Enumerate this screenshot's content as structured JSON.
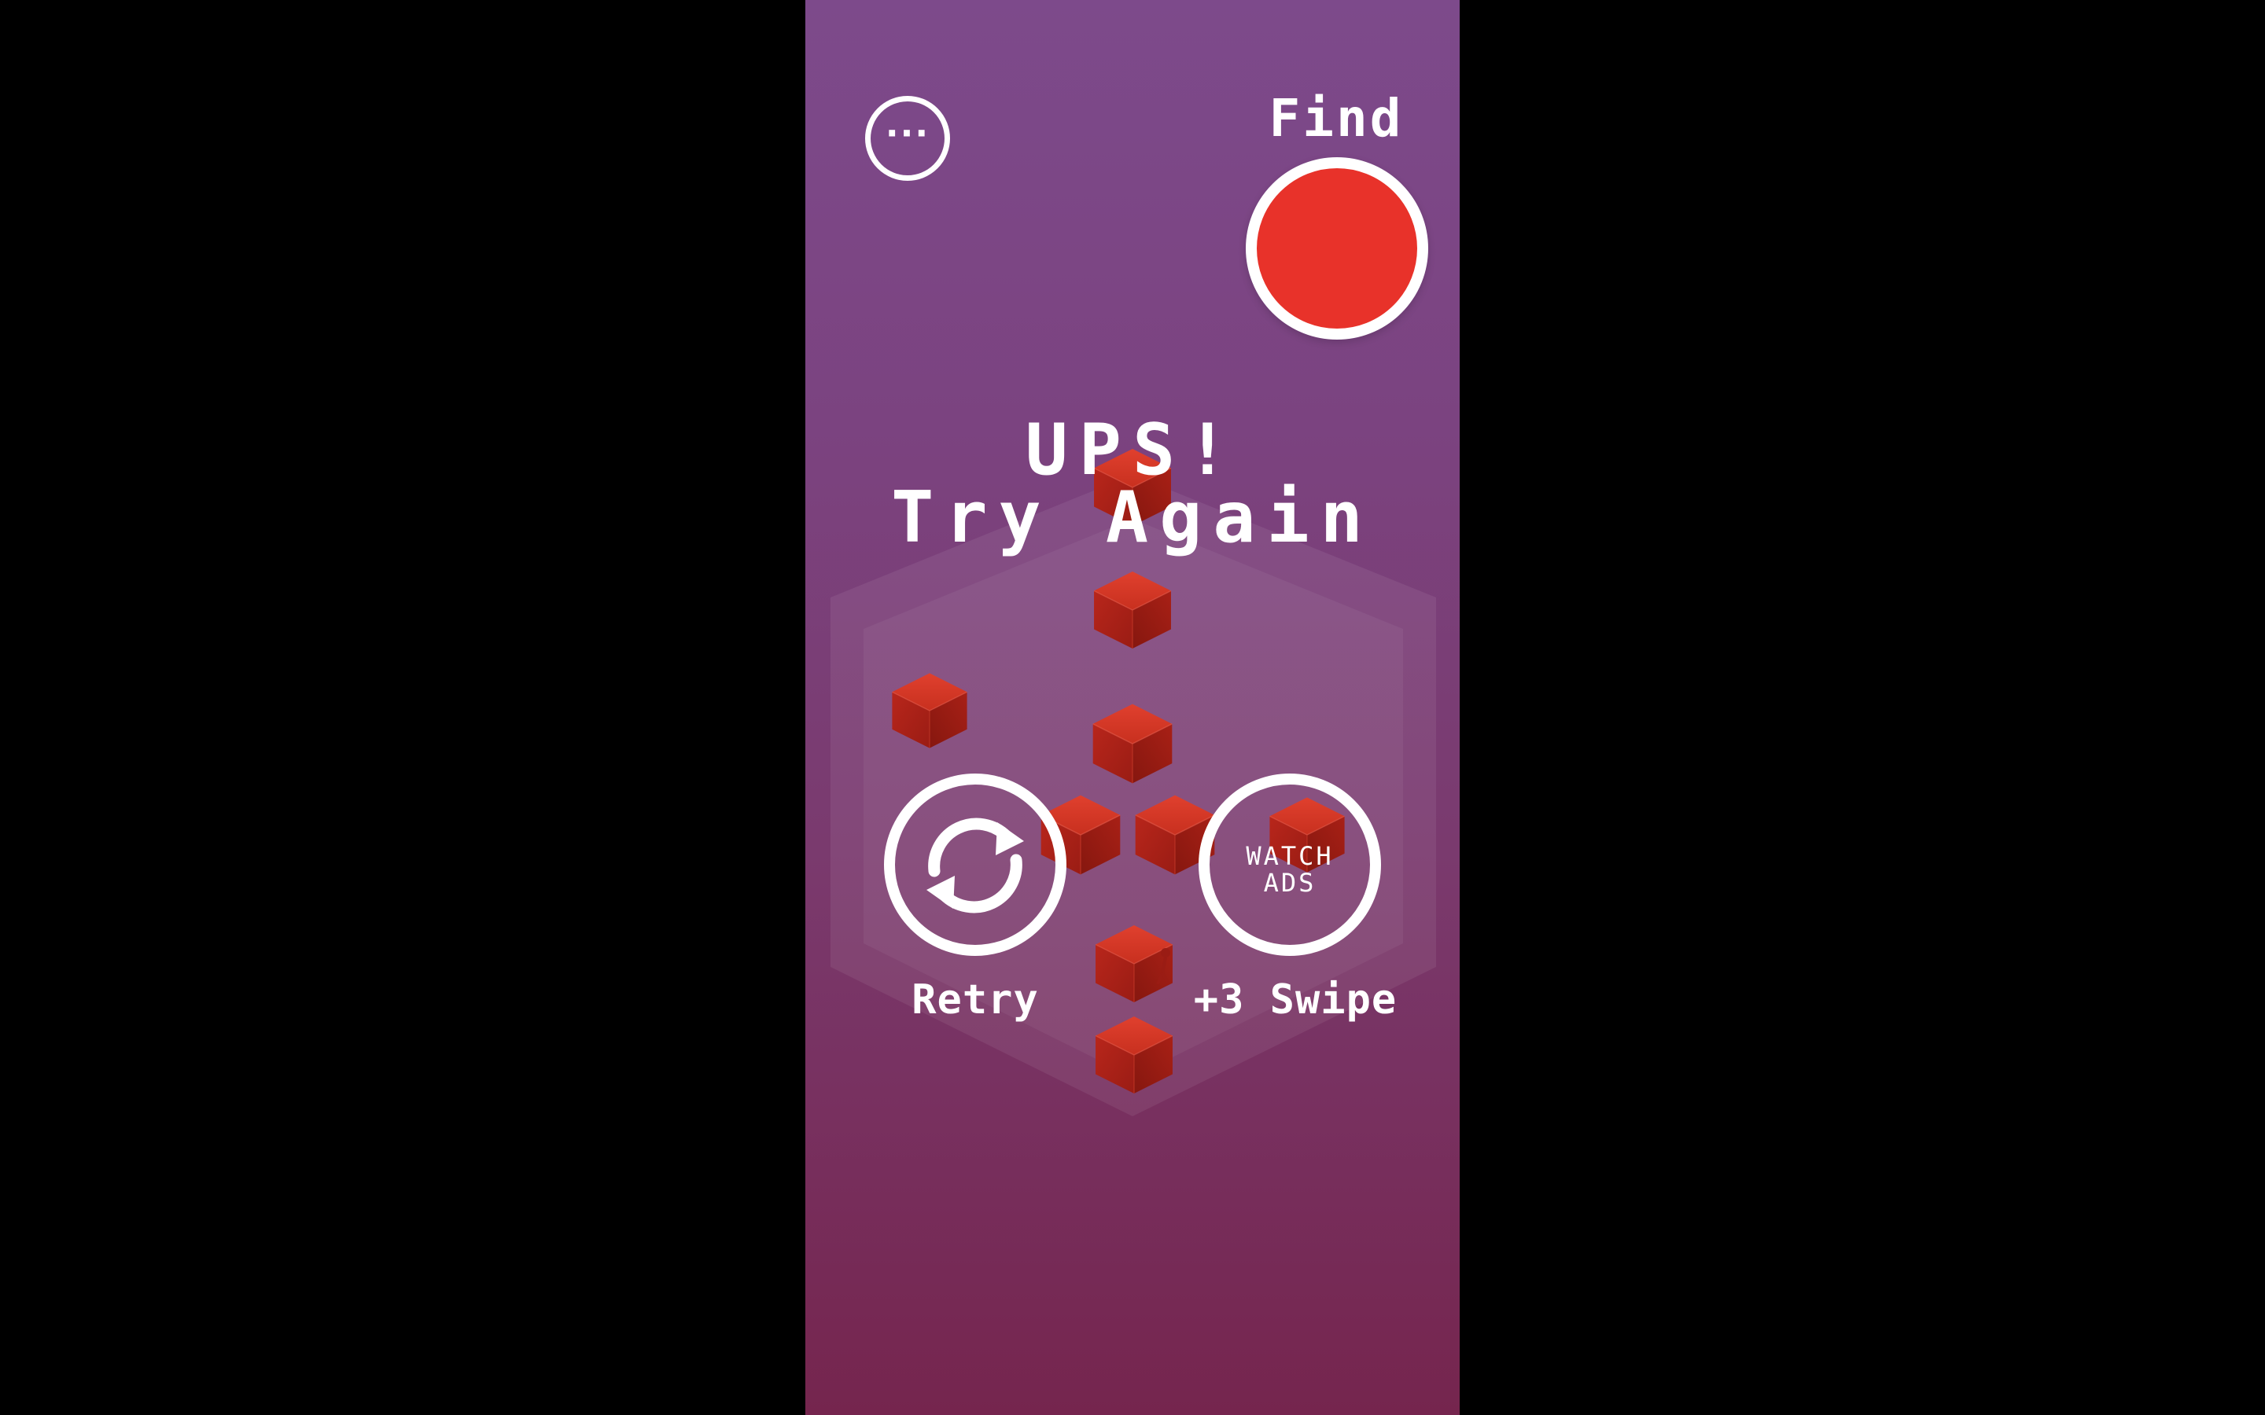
{
  "colors": {
    "background_top": "#7d4a8b",
    "background_bottom": "#75254e",
    "target_red": "#e8322a",
    "cube_red": "#c0281c",
    "foreground": "#ffffff"
  },
  "menu": {
    "icon": "more-horizontal-icon",
    "glyph": "···"
  },
  "find": {
    "label": "Find",
    "target_shape": "circle",
    "target_color": "#e8322a"
  },
  "message": {
    "line1": "UPS!",
    "line2": "Try Again"
  },
  "actions": {
    "retry": {
      "icon": "refresh-icon",
      "label": "Retry"
    },
    "watch_ads": {
      "button_line1": "WATCH",
      "button_line2": "ADS",
      "label": "+3 Swipe"
    }
  }
}
